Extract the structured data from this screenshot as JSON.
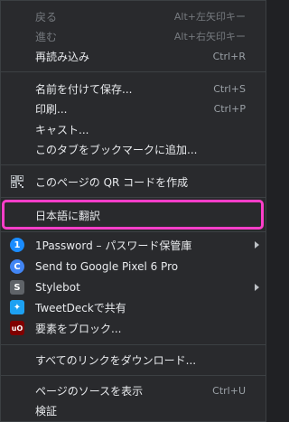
{
  "menu": {
    "back": {
      "label": "戻る",
      "accel": "Alt+左矢印キー"
    },
    "forward": {
      "label": "進む",
      "accel": "Alt+右矢印キー"
    },
    "reload": {
      "label": "再読み込み",
      "accel": "Ctrl+R"
    },
    "save_as": {
      "label": "名前を付けて保存...",
      "accel": "Ctrl+S"
    },
    "print": {
      "label": "印刷...",
      "accel": "Ctrl+P"
    },
    "cast": {
      "label": "キャスト..."
    },
    "bookmark": {
      "label": "このタブをブックマークに追加..."
    },
    "qr": {
      "label": "このページの QR コードを作成",
      "icon": "qr-code-icon"
    },
    "translate": {
      "label": "日本語に翻訳"
    },
    "extensions": [
      {
        "label": "1Password – パスワード保管庫",
        "icon": "1password-icon",
        "submenu": true
      },
      {
        "label": "Send to Google Pixel 6 Pro",
        "icon": "chrome-send-icon",
        "submenu": false
      },
      {
        "label": "Stylebot",
        "icon": "stylebot-icon",
        "submenu": true
      },
      {
        "label": "TweetDeckで共有",
        "icon": "tweetdeck-icon",
        "submenu": false
      },
      {
        "label": "要素をブロック...",
        "icon": "ublock-icon",
        "submenu": false
      }
    ],
    "download_links": {
      "label": "すべてのリンクをダウンロード..."
    },
    "view_source": {
      "label": "ページのソースを表示",
      "accel": "Ctrl+U"
    },
    "inspect": {
      "label": "検証"
    }
  },
  "colors": {
    "highlight": "#ff3ec9",
    "background": "#292a2d"
  }
}
